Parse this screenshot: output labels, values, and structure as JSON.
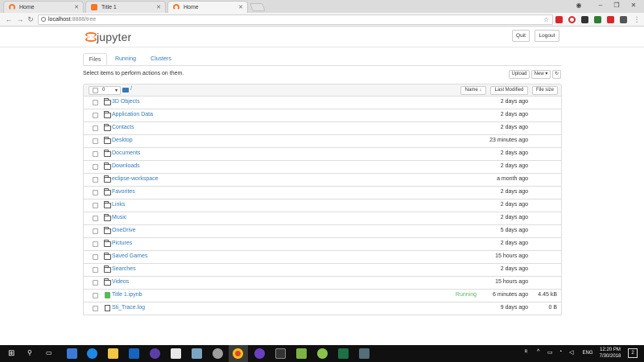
{
  "browser": {
    "tabs": [
      {
        "title": "Home",
        "favicon": "jupyter-icon",
        "active": false
      },
      {
        "title": "Title 1",
        "favicon": "notebook-icon",
        "active": false
      },
      {
        "title": "Home",
        "favicon": "jupyter-icon",
        "active": true
      }
    ],
    "url_host": "localhost",
    "url_path": ":8888/tree"
  },
  "header": {
    "logo_text": "jupyter",
    "quit_label": "Quit",
    "logout_label": "Logout"
  },
  "nav_tabs": [
    "Files",
    "Running",
    "Clusters"
  ],
  "select_message": "Select items to perform actions on them.",
  "actions": {
    "upload_label": "Upload",
    "new_label": "New ▾",
    "refresh_icon": "refresh-icon"
  },
  "list_header": {
    "selected_count": "0",
    "breadcrumb": "/",
    "sort_name_label": "Name ↓",
    "last_modified_label": "Last Modified",
    "file_size_label": "File size"
  },
  "items": [
    {
      "name": "3D Objects",
      "type": "folder",
      "status": "",
      "modified": "2 days ago",
      "size": ""
    },
    {
      "name": "Application Data",
      "type": "folder",
      "status": "",
      "modified": "2 days ago",
      "size": ""
    },
    {
      "name": "Contacts",
      "type": "folder",
      "status": "",
      "modified": "2 days ago",
      "size": ""
    },
    {
      "name": "Desktop",
      "type": "folder",
      "status": "",
      "modified": "23 minutes ago",
      "size": ""
    },
    {
      "name": "Documents",
      "type": "folder",
      "status": "",
      "modified": "2 days ago",
      "size": ""
    },
    {
      "name": "Downloads",
      "type": "folder",
      "status": "",
      "modified": "2 days ago",
      "size": ""
    },
    {
      "name": "eclipse-workspace",
      "type": "folder",
      "status": "",
      "modified": "a month ago",
      "size": ""
    },
    {
      "name": "Favorites",
      "type": "folder",
      "status": "",
      "modified": "2 days ago",
      "size": ""
    },
    {
      "name": "Links",
      "type": "folder",
      "status": "",
      "modified": "2 days ago",
      "size": ""
    },
    {
      "name": "Music",
      "type": "folder",
      "status": "",
      "modified": "2 days ago",
      "size": ""
    },
    {
      "name": "OneDrive",
      "type": "folder",
      "status": "",
      "modified": "5 days ago",
      "size": ""
    },
    {
      "name": "Pictures",
      "type": "folder",
      "status": "",
      "modified": "2 days ago",
      "size": ""
    },
    {
      "name": "Saved Games",
      "type": "folder",
      "status": "",
      "modified": "15 hours ago",
      "size": ""
    },
    {
      "name": "Searches",
      "type": "folder",
      "status": "",
      "modified": "2 days ago",
      "size": ""
    },
    {
      "name": "Videos",
      "type": "folder",
      "status": "",
      "modified": "15 hours ago",
      "size": ""
    },
    {
      "name": "Title 1.ipynb",
      "type": "notebook",
      "status": "Running",
      "modified": "6 minutes ago",
      "size": "4.45 kB"
    },
    {
      "name": "Sti_Trace.log",
      "type": "file",
      "status": "",
      "modified": "9 days ago",
      "size": "0 B"
    }
  ],
  "taskbar": {
    "language": "ENG",
    "time": "12:20 PM",
    "date": "7/30/2018",
    "notification_count": "2"
  },
  "colors": {
    "link": "#337ab7",
    "running": "#5cb85c",
    "jupyter_orange": "#f37726",
    "taskbar": "#101010"
  }
}
